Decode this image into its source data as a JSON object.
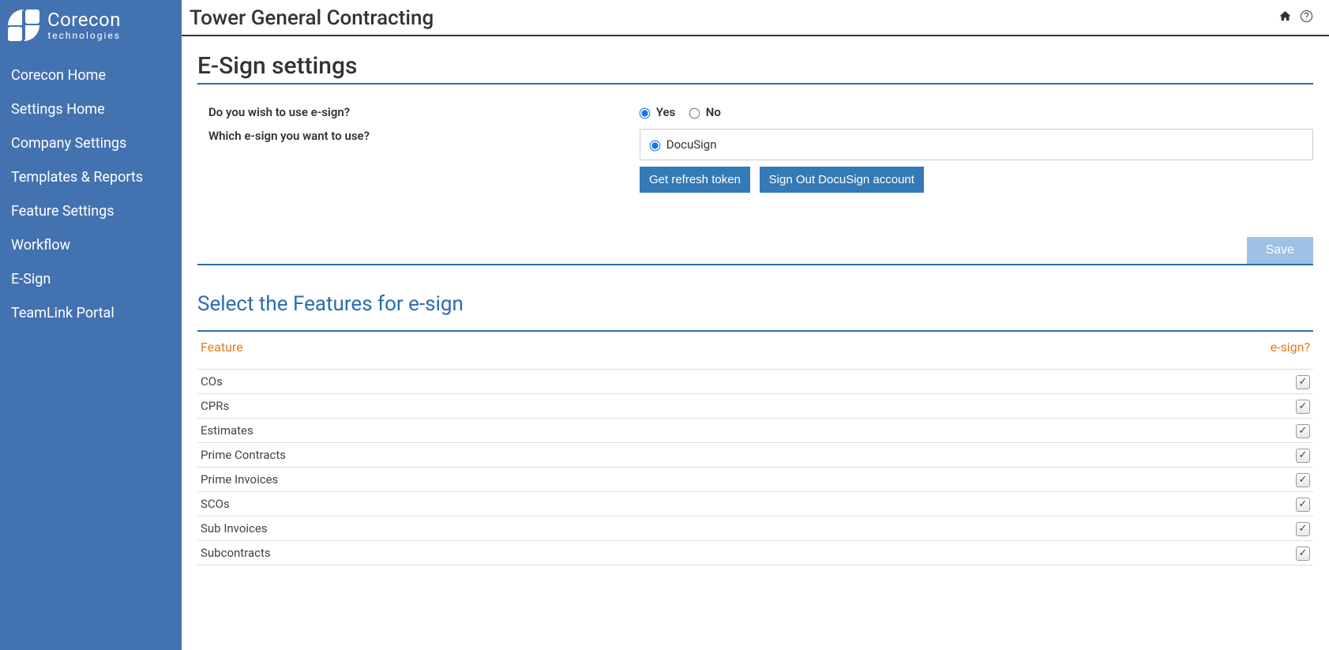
{
  "logo": {
    "main": "Corecon",
    "sub": "technologies"
  },
  "sidebar": {
    "items": [
      {
        "label": "Corecon Home"
      },
      {
        "label": "Settings Home"
      },
      {
        "label": "Company Settings"
      },
      {
        "label": "Templates & Reports"
      },
      {
        "label": "Feature Settings"
      },
      {
        "label": "Workflow"
      },
      {
        "label": "E-Sign"
      },
      {
        "label": "TeamLink Portal"
      }
    ]
  },
  "header": {
    "title": "Tower General Contracting"
  },
  "page": {
    "title": "E-Sign settings",
    "q_use_esign": "Do you wish to use e-sign?",
    "yes_label": "Yes",
    "no_label": "No",
    "q_provider": "Which e-sign you want to use?",
    "provider_docusign": "DocuSign",
    "btn_refresh": "Get refresh token",
    "btn_signout": "Sign Out DocuSign account",
    "btn_save": "Save",
    "section_features": "Select the Features for e-sign",
    "col_feature": "Feature",
    "col_esign": "e-sign?"
  },
  "features": [
    {
      "name": "COs",
      "checked": true
    },
    {
      "name": "CPRs",
      "checked": true
    },
    {
      "name": "Estimates",
      "checked": true
    },
    {
      "name": "Prime Contracts",
      "checked": true
    },
    {
      "name": "Prime Invoices",
      "checked": true
    },
    {
      "name": "SCOs",
      "checked": true
    },
    {
      "name": "Sub Invoices",
      "checked": true
    },
    {
      "name": "Subcontracts",
      "checked": true
    }
  ]
}
